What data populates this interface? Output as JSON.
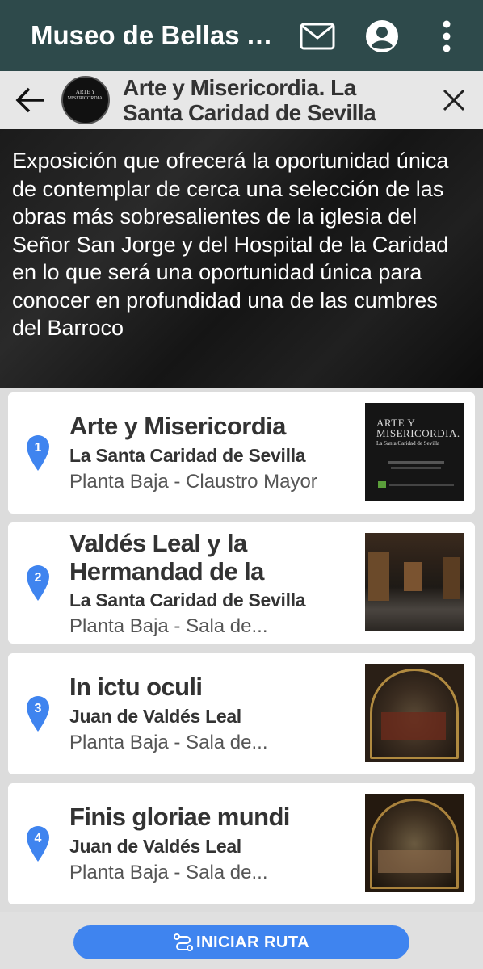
{
  "app": {
    "title": "Museo de Bellas Artes de Sevilla"
  },
  "header": {
    "title": "Arte y Misericordia. La Santa Caridad de Sevilla",
    "logo_text": "ARTE Y MISERICORDIA. La Santa Caridad de Sevilla"
  },
  "description": "Exposición que ofrecerá la oportunidad única de contemplar de cerca una selección de las obras más sobresalientes de la iglesia del Señor San Jorge y del Hospital de la Caridad en lo que será una oportunidad única para conocer en profundidad una de las cumbres del Barroco",
  "stops": [
    {
      "number": "1",
      "title": "Arte y Misericordia",
      "subtitle": "La Santa Caridad de Sevilla",
      "location": "Planta Baja - Claustro Mayor"
    },
    {
      "number": "2",
      "title": "Valdés Leal y la Hermandad de la Caridad",
      "subtitle": "La Santa Caridad de Sevilla",
      "location": "Planta Baja - Sala de..."
    },
    {
      "number": "3",
      "title": "In ictu oculi",
      "subtitle": "Juan de Valdés Leal",
      "location": "Planta Baja - Sala de..."
    },
    {
      "number": "4",
      "title": "Finis gloriae mundi",
      "subtitle": "Juan de Valdés Leal",
      "location": "Planta Baja - Sala de..."
    }
  ],
  "poster": {
    "line1": "ARTE Y",
    "line2": "MISERICORDIA.",
    "line3": "La Santa Caridad de Sevilla"
  },
  "start_button": "INICIAR RUTA",
  "colors": {
    "topbar": "#2e4a4b",
    "pin": "#3f84ef",
    "button": "#3f84ef"
  }
}
